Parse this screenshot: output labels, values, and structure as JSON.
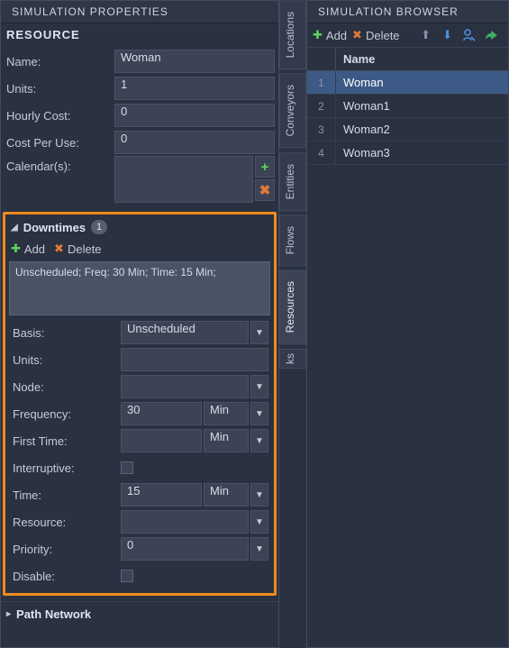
{
  "left": {
    "title": "SIMULATION PROPERTIES",
    "resource_header": "RESOURCE",
    "props": {
      "name_label": "Name:",
      "name_value": "Woman",
      "units_label": "Units:",
      "units_value": "1",
      "hourly_label": "Hourly Cost:",
      "hourly_value": "0",
      "cpu_label": "Cost Per Use:",
      "cpu_value": "0",
      "calendar_label": "Calendar(s):"
    },
    "downtimes": {
      "header": "Downtimes",
      "count": "1",
      "add_label": "Add",
      "delete_label": "Delete",
      "list_item": "Unscheduled; Freq: 30 Min; Time: 15 Min;",
      "basis_label": "Basis:",
      "basis_value": "Unscheduled",
      "units_label": "Units:",
      "units_value": "",
      "node_label": "Node:",
      "node_value": "",
      "freq_label": "Frequency:",
      "freq_value": "30",
      "freq_unit": "Min",
      "first_label": "First Time:",
      "first_value": "",
      "first_unit": "Min",
      "interrupt_label": "Interruptive:",
      "time_label": "Time:",
      "time_value": "15",
      "time_unit": "Min",
      "resource_label": "Resource:",
      "resource_value": "",
      "priority_label": "Priority:",
      "priority_value": "0",
      "disable_label": "Disable:"
    },
    "path_header": "Path Network"
  },
  "vtabs": {
    "locations": "Locations",
    "conveyors": "Conveyors",
    "entities": "Entities",
    "flows": "Flows",
    "resources": "Resources",
    "last": "ks"
  },
  "right": {
    "title": "SIMULATION BROWSER",
    "add_label": "Add",
    "delete_label": "Delete",
    "col_name": "Name",
    "rows": [
      {
        "num": "1",
        "name": "Woman"
      },
      {
        "num": "2",
        "name": "Woman1"
      },
      {
        "num": "3",
        "name": "Woman2"
      },
      {
        "num": "4",
        "name": "Woman3"
      }
    ]
  }
}
